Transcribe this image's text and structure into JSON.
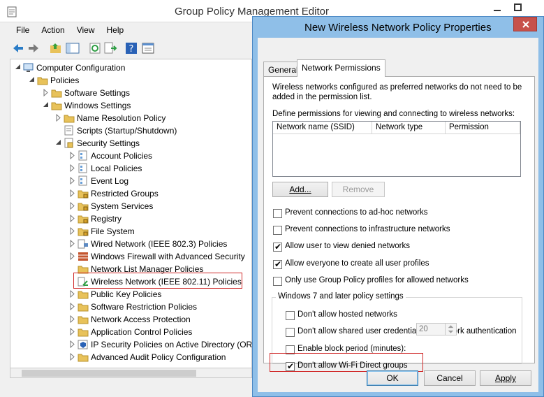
{
  "main_window": {
    "title": "Group Policy Management Editor",
    "menu": [
      "File",
      "Action",
      "View",
      "Help"
    ],
    "toolbar_icons": [
      "back-arrow-icon",
      "forward-arrow-icon",
      "up-folder-icon",
      "show-hide-tree-icon",
      "refresh-icon",
      "export-list-icon",
      "help-icon",
      "properties-icon"
    ],
    "tree": [
      {
        "label": "Computer Configuration",
        "depth": 1,
        "expander": "open",
        "icon": "computer-icon"
      },
      {
        "label": "Policies",
        "depth": 2,
        "expander": "open",
        "icon": "folder-icon"
      },
      {
        "label": "Software Settings",
        "depth": 3,
        "expander": "closed",
        "icon": "folder-icon"
      },
      {
        "label": "Windows Settings",
        "depth": 3,
        "expander": "open",
        "icon": "folder-icon"
      },
      {
        "label": "Name Resolution Policy",
        "depth": 4,
        "expander": "closed",
        "icon": "folder-icon"
      },
      {
        "label": "Scripts (Startup/Shutdown)",
        "depth": 4,
        "expander": "none",
        "icon": "script-icon"
      },
      {
        "label": "Security Settings",
        "depth": 4,
        "expander": "open",
        "icon": "security-icon"
      },
      {
        "label": "Account Policies",
        "depth": 5,
        "expander": "closed",
        "icon": "policy-icon"
      },
      {
        "label": "Local Policies",
        "depth": 5,
        "expander": "closed",
        "icon": "policy-icon"
      },
      {
        "label": "Event Log",
        "depth": 5,
        "expander": "closed",
        "icon": "policy-icon"
      },
      {
        "label": "Restricted Groups",
        "depth": 5,
        "expander": "closed",
        "icon": "lock-folder-icon"
      },
      {
        "label": "System Services",
        "depth": 5,
        "expander": "closed",
        "icon": "lock-folder-icon"
      },
      {
        "label": "Registry",
        "depth": 5,
        "expander": "closed",
        "icon": "lock-folder-icon"
      },
      {
        "label": "File System",
        "depth": 5,
        "expander": "closed",
        "icon": "lock-folder-icon"
      },
      {
        "label": "Wired Network (IEEE 802.3) Policies",
        "depth": 5,
        "expander": "closed",
        "icon": "wired-network-icon"
      },
      {
        "label": "Windows Firewall with Advanced Security",
        "depth": 5,
        "expander": "closed",
        "icon": "firewall-icon"
      },
      {
        "label": "Network List Manager Policies",
        "depth": 5,
        "expander": "none",
        "icon": "folder-icon"
      },
      {
        "label": "Wireless Network (IEEE 802.11) Policies",
        "depth": 5,
        "expander": "none",
        "icon": "wireless-network-icon"
      },
      {
        "label": "Public Key Policies",
        "depth": 5,
        "expander": "closed",
        "icon": "folder-icon"
      },
      {
        "label": "Software Restriction Policies",
        "depth": 5,
        "expander": "closed",
        "icon": "folder-icon"
      },
      {
        "label": "Network Access Protection",
        "depth": 5,
        "expander": "closed",
        "icon": "folder-icon"
      },
      {
        "label": "Application Control Policies",
        "depth": 5,
        "expander": "closed",
        "icon": "folder-icon"
      },
      {
        "label": "IP Security Policies on Active Directory (OR",
        "depth": 5,
        "expander": "closed",
        "icon": "ip-security-icon"
      },
      {
        "label": "Advanced Audit Policy Configuration",
        "depth": 5,
        "expander": "closed",
        "icon": "folder-icon"
      }
    ],
    "highlighted_item": "Wireless Network (IEEE 802.11) Policies"
  },
  "dialog": {
    "title": "New Wireless Network Policy Properties",
    "tabs": [
      {
        "label": "General",
        "active": false
      },
      {
        "label": "Network Permissions",
        "active": true
      }
    ],
    "intro_line1": "Wireless networks configured as preferred networks do not need to be",
    "intro_line2": "added in the permission list.",
    "define_label": "Define permissions for viewing and connecting to wireless networks:",
    "columns": [
      "Network name (SSID)",
      "Network type",
      "Permission"
    ],
    "add_button": "Add...",
    "remove_button": "Remove",
    "options": [
      {
        "label": "Prevent connections to ad-hoc networks",
        "checked": false
      },
      {
        "label": "Prevent connections to infrastructure networks",
        "checked": false
      },
      {
        "label": "Allow user to view denied networks",
        "checked": true
      },
      {
        "label": "Allow everyone to create all user profiles",
        "checked": true
      },
      {
        "label": "Only use Group Policy profiles for allowed networks",
        "checked": false
      }
    ],
    "win7_group_label": "Windows 7 and later policy settings",
    "win7_options": [
      {
        "label": "Don't allow hosted networks",
        "checked": false
      },
      {
        "label": "Don't allow shared user credentials for network authentication",
        "checked": false
      },
      {
        "label": "Enable block period (minutes):",
        "checked": false
      },
      {
        "label": "Don't allow Wi-Fi Direct groups",
        "checked": true
      }
    ],
    "block_period_value": "20",
    "ok_button": "OK",
    "cancel_button": "Cancel",
    "apply_button": "Apply"
  },
  "colors": {
    "highlight": "#d02a2a",
    "dialog_frame": "#8fbfe8",
    "close_button": "#c7514b"
  }
}
